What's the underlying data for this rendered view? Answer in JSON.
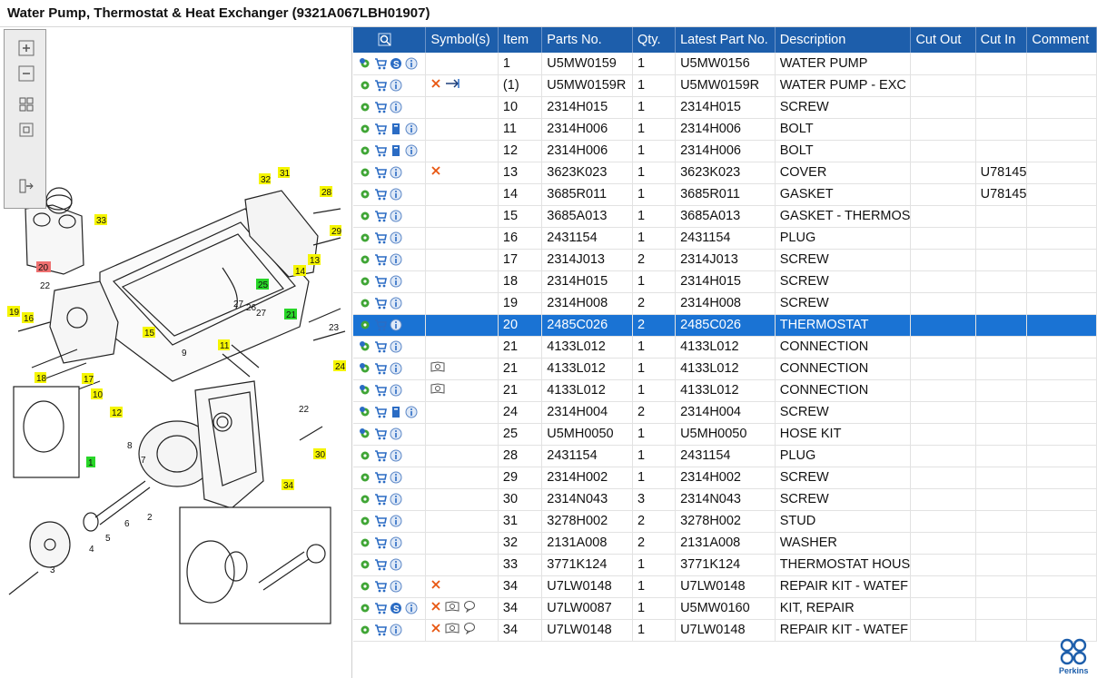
{
  "title": "Water Pump, Thermostat & Heat Exchanger (9321A067LBH01907)",
  "toolbar": {
    "zoom_in_icon": "zoom-in-icon",
    "zoom_out_icon": "zoom-out-icon",
    "fit_icon": "fit-page-icon",
    "actual_size_icon": "actual-size-icon",
    "export_icon": "export-icon"
  },
  "columns": [
    "",
    "Symbol(s)",
    "Item",
    "Parts No.",
    "Qty.",
    "Latest Part No.",
    "Description",
    "Cut Out",
    "Cut In",
    "Comment"
  ],
  "rows": [
    {
      "icons": [
        "gears",
        "cart",
        "s",
        "info"
      ],
      "symbols": [],
      "item": "1",
      "part": "U5MW0159",
      "qty": "1",
      "latest": "U5MW0156",
      "desc": "WATER PUMP",
      "cut_out": "",
      "cut_in": "",
      "comment": ""
    },
    {
      "icons": [
        "gear",
        "cart",
        "info"
      ],
      "symbols": [
        "cross",
        "arrow"
      ],
      "item": "(1)",
      "part": "U5MW0159R",
      "qty": "1",
      "latest": "U5MW0159R",
      "desc": "WATER PUMP - EXC",
      "cut_out": "",
      "cut_in": "",
      "comment": ""
    },
    {
      "icons": [
        "gear",
        "cart",
        "info"
      ],
      "symbols": [],
      "item": "10",
      "part": "2314H015",
      "qty": "1",
      "latest": "2314H015",
      "desc": "SCREW",
      "cut_out": "",
      "cut_in": "",
      "comment": ""
    },
    {
      "icons": [
        "gear",
        "cart",
        "book",
        "info"
      ],
      "symbols": [],
      "item": "11",
      "part": "2314H006",
      "qty": "1",
      "latest": "2314H006",
      "desc": "BOLT",
      "cut_out": "",
      "cut_in": "",
      "comment": ""
    },
    {
      "icons": [
        "gear",
        "cart",
        "book",
        "info"
      ],
      "symbols": [],
      "item": "12",
      "part": "2314H006",
      "qty": "1",
      "latest": "2314H006",
      "desc": "BOLT",
      "cut_out": "",
      "cut_in": "",
      "comment": ""
    },
    {
      "icons": [
        "gear",
        "cart",
        "info"
      ],
      "symbols": [
        "cross"
      ],
      "item": "13",
      "part": "3623K023",
      "qty": "1",
      "latest": "3623K023",
      "desc": "COVER",
      "cut_out": "",
      "cut_in": "U78145",
      "comment": ""
    },
    {
      "icons": [
        "gear",
        "cart",
        "info"
      ],
      "symbols": [],
      "item": "14",
      "part": "3685R011",
      "qty": "1",
      "latest": "3685R011",
      "desc": "GASKET",
      "cut_out": "",
      "cut_in": "U78145",
      "comment": ""
    },
    {
      "icons": [
        "gear",
        "cart",
        "info"
      ],
      "symbols": [],
      "item": "15",
      "part": "3685A013",
      "qty": "1",
      "latest": "3685A013",
      "desc": "GASKET - THERMOS",
      "cut_out": "",
      "cut_in": "",
      "comment": ""
    },
    {
      "icons": [
        "gear",
        "cart",
        "info"
      ],
      "symbols": [],
      "item": "16",
      "part": "2431154",
      "qty": "1",
      "latest": "2431154",
      "desc": "PLUG",
      "cut_out": "",
      "cut_in": "",
      "comment": ""
    },
    {
      "icons": [
        "gear",
        "cart",
        "info"
      ],
      "symbols": [],
      "item": "17",
      "part": "2314J013",
      "qty": "2",
      "latest": "2314J013",
      "desc": "SCREW",
      "cut_out": "",
      "cut_in": "",
      "comment": ""
    },
    {
      "icons": [
        "gear",
        "cart",
        "info"
      ],
      "symbols": [],
      "item": "18",
      "part": "2314H015",
      "qty": "1",
      "latest": "2314H015",
      "desc": "SCREW",
      "cut_out": "",
      "cut_in": "",
      "comment": ""
    },
    {
      "icons": [
        "gear",
        "cart",
        "info"
      ],
      "symbols": [],
      "item": "19",
      "part": "2314H008",
      "qty": "2",
      "latest": "2314H008",
      "desc": "SCREW",
      "cut_out": "",
      "cut_in": "",
      "comment": ""
    },
    {
      "icons": [
        "gear",
        "cart",
        "info"
      ],
      "symbols": [],
      "item": "20",
      "part": "2485C026",
      "qty": "2",
      "latest": "2485C026",
      "desc": "THERMOSTAT",
      "cut_out": "",
      "cut_in": "",
      "comment": "",
      "selected": true
    },
    {
      "icons": [
        "gears",
        "cart",
        "info"
      ],
      "symbols": [],
      "item": "21",
      "part": "4133L012",
      "qty": "1",
      "latest": "4133L012",
      "desc": "CONNECTION",
      "cut_out": "",
      "cut_in": "",
      "comment": ""
    },
    {
      "icons": [
        "gears",
        "cart",
        "info"
      ],
      "symbols": [
        "viewer"
      ],
      "item": "21",
      "part": "4133L012",
      "qty": "1",
      "latest": "4133L012",
      "desc": "CONNECTION",
      "cut_out": "",
      "cut_in": "",
      "comment": ""
    },
    {
      "icons": [
        "gears",
        "cart",
        "info"
      ],
      "symbols": [
        "viewer"
      ],
      "item": "21",
      "part": "4133L012",
      "qty": "1",
      "latest": "4133L012",
      "desc": "CONNECTION",
      "cut_out": "",
      "cut_in": "",
      "comment": ""
    },
    {
      "icons": [
        "gears",
        "cart",
        "book",
        "info"
      ],
      "symbols": [],
      "item": "24",
      "part": "2314H004",
      "qty": "2",
      "latest": "2314H004",
      "desc": "SCREW",
      "cut_out": "",
      "cut_in": "",
      "comment": ""
    },
    {
      "icons": [
        "gears",
        "cart",
        "info"
      ],
      "symbols": [],
      "item": "25",
      "part": "U5MH0050",
      "qty": "1",
      "latest": "U5MH0050",
      "desc": "HOSE KIT",
      "cut_out": "",
      "cut_in": "",
      "comment": ""
    },
    {
      "icons": [
        "gear",
        "cart",
        "info"
      ],
      "symbols": [],
      "item": "28",
      "part": "2431154",
      "qty": "1",
      "latest": "2431154",
      "desc": "PLUG",
      "cut_out": "",
      "cut_in": "",
      "comment": ""
    },
    {
      "icons": [
        "gear",
        "cart",
        "info"
      ],
      "symbols": [],
      "item": "29",
      "part": "2314H002",
      "qty": "1",
      "latest": "2314H002",
      "desc": "SCREW",
      "cut_out": "",
      "cut_in": "",
      "comment": ""
    },
    {
      "icons": [
        "gear",
        "cart",
        "info"
      ],
      "symbols": [],
      "item": "30",
      "part": "2314N043",
      "qty": "3",
      "latest": "2314N043",
      "desc": "SCREW",
      "cut_out": "",
      "cut_in": "",
      "comment": ""
    },
    {
      "icons": [
        "gear",
        "cart",
        "info"
      ],
      "symbols": [],
      "item": "31",
      "part": "3278H002",
      "qty": "2",
      "latest": "3278H002",
      "desc": "STUD",
      "cut_out": "",
      "cut_in": "",
      "comment": ""
    },
    {
      "icons": [
        "gear",
        "cart",
        "info"
      ],
      "symbols": [],
      "item": "32",
      "part": "2131A008",
      "qty": "2",
      "latest": "2131A008",
      "desc": "WASHER",
      "cut_out": "",
      "cut_in": "",
      "comment": ""
    },
    {
      "icons": [
        "gear",
        "cart",
        "info"
      ],
      "symbols": [],
      "item": "33",
      "part": "3771K124",
      "qty": "1",
      "latest": "3771K124",
      "desc": "THERMOSTAT HOUS",
      "cut_out": "",
      "cut_in": "",
      "comment": ""
    },
    {
      "icons": [
        "gear",
        "cart",
        "info"
      ],
      "symbols": [
        "cross"
      ],
      "item": "34",
      "part": "U7LW0148",
      "qty": "1",
      "latest": "U7LW0148",
      "desc": "REPAIR KIT - WATEF",
      "cut_out": "",
      "cut_in": "",
      "comment": ""
    },
    {
      "icons": [
        "gear",
        "cart",
        "s",
        "info"
      ],
      "symbols": [
        "cross",
        "viewer",
        "bubble"
      ],
      "item": "34",
      "part": "U7LW0087",
      "qty": "1",
      "latest": "U5MW0160",
      "desc": "KIT, REPAIR",
      "cut_out": "",
      "cut_in": "",
      "comment": ""
    },
    {
      "icons": [
        "gear",
        "cart",
        "info"
      ],
      "symbols": [
        "cross",
        "viewer",
        "bubble"
      ],
      "item": "34",
      "part": "U7LW0148",
      "qty": "1",
      "latest": "U7LW0148",
      "desc": "REPAIR KIT - WATEF",
      "cut_out": "",
      "cut_in": "",
      "comment": ""
    }
  ],
  "callouts": [
    {
      "label": "31",
      "color": "yellow"
    },
    {
      "label": "32",
      "color": "yellow"
    },
    {
      "label": "28",
      "color": "yellow"
    },
    {
      "label": "33",
      "color": "yellow"
    },
    {
      "label": "29",
      "color": "yellow"
    },
    {
      "label": "13",
      "color": "yellow"
    },
    {
      "label": "14",
      "color": "yellow"
    },
    {
      "label": "20",
      "color": "red"
    },
    {
      "label": "22",
      "color": "none"
    },
    {
      "label": "25",
      "color": "green"
    },
    {
      "label": "27",
      "color": "none"
    },
    {
      "label": "26",
      "color": "none"
    },
    {
      "label": "27",
      "color": "none"
    },
    {
      "label": "21",
      "color": "green"
    },
    {
      "label": "23",
      "color": "none"
    },
    {
      "label": "19",
      "color": "yellow"
    },
    {
      "label": "16",
      "color": "yellow"
    },
    {
      "label": "15",
      "color": "yellow"
    },
    {
      "label": "11",
      "color": "yellow"
    },
    {
      "label": "24",
      "color": "yellow"
    },
    {
      "label": "9",
      "color": "none"
    },
    {
      "label": "18",
      "color": "yellow"
    },
    {
      "label": "17",
      "color": "yellow"
    },
    {
      "label": "22",
      "color": "none"
    },
    {
      "label": "10",
      "color": "yellow"
    },
    {
      "label": "12",
      "color": "yellow"
    },
    {
      "label": "8",
      "color": "none"
    },
    {
      "label": "7",
      "color": "none"
    },
    {
      "label": "30",
      "color": "yellow"
    },
    {
      "label": "1",
      "color": "green"
    },
    {
      "label": "34",
      "color": "yellow"
    },
    {
      "label": "2",
      "color": "none"
    },
    {
      "label": "6",
      "color": "none"
    },
    {
      "label": "5",
      "color": "none"
    },
    {
      "label": "4",
      "color": "none"
    },
    {
      "label": "3",
      "color": "none"
    }
  ],
  "logo": {
    "name": "perkins-logo",
    "text": "Perkins"
  },
  "colors": {
    "header": "#1d5eab",
    "selected": "#1a73d4",
    "yellow": "#f5f500",
    "green": "#28d628",
    "red": "#ee7070"
  }
}
